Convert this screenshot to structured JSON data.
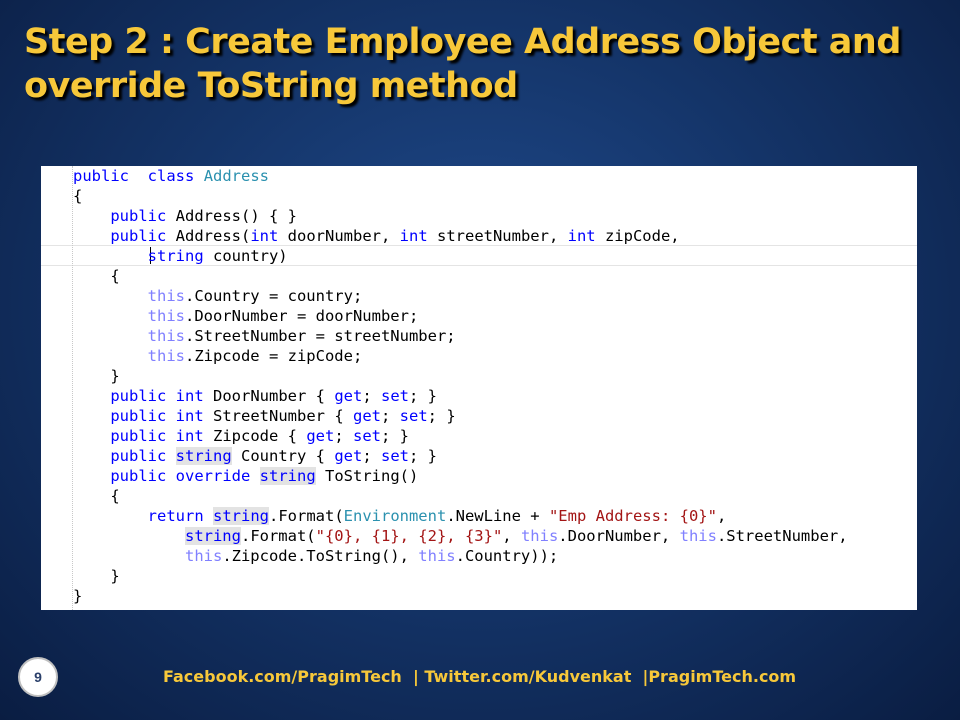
{
  "slide": {
    "title_line1": "Step 2 : Create Employee Address Object and",
    "title_line2": "override ToString method",
    "page_number": "9",
    "footer": "Facebook.com/PragimTech  | Twitter.com/Kudvenkat  |PragimTech.com"
  },
  "colors": {
    "title": "#f7c83a",
    "background": "#143468",
    "keyword": "#0000ff",
    "type": "#2b91af",
    "string": "#a31515",
    "this_keyword": "#8080ff"
  },
  "code": {
    "language": "C#",
    "lines": [
      [
        [
          "kw",
          "public"
        ],
        [
          "",
          "  "
        ],
        [
          "kw",
          "class"
        ],
        [
          "",
          " "
        ],
        [
          "ty",
          "Address"
        ]
      ],
      [
        [
          "",
          "{"
        ]
      ],
      [
        [
          "",
          "    "
        ],
        [
          "kw",
          "public"
        ],
        [
          "",
          " Address() { }"
        ]
      ],
      [
        [
          "",
          "    "
        ],
        [
          "kw",
          "public"
        ],
        [
          "",
          " Address("
        ],
        [
          "kw",
          "int"
        ],
        [
          "",
          " doorNumber, "
        ],
        [
          "kw",
          "int"
        ],
        [
          "",
          " streetNumber, "
        ],
        [
          "kw",
          "int"
        ],
        [
          "",
          " zipCode,"
        ]
      ],
      [
        [
          "",
          "        "
        ],
        [
          "kw",
          "string"
        ],
        [
          "",
          " country)"
        ]
      ],
      [
        [
          "",
          "    {"
        ]
      ],
      [
        [
          "",
          "        "
        ],
        [
          "ths",
          "this"
        ],
        [
          "",
          ".Country = country;"
        ]
      ],
      [
        [
          "",
          "        "
        ],
        [
          "ths",
          "this"
        ],
        [
          "",
          ".DoorNumber = doorNumber;"
        ]
      ],
      [
        [
          "",
          "        "
        ],
        [
          "ths",
          "this"
        ],
        [
          "",
          ".StreetNumber = streetNumber;"
        ]
      ],
      [
        [
          "",
          "        "
        ],
        [
          "ths",
          "this"
        ],
        [
          "",
          ".Zipcode = zipCode;"
        ]
      ],
      [
        [
          "",
          "    }"
        ]
      ],
      [
        [
          "",
          "    "
        ],
        [
          "kw",
          "public"
        ],
        [
          "",
          " "
        ],
        [
          "kw",
          "int"
        ],
        [
          "",
          " DoorNumber { "
        ],
        [
          "kw",
          "get"
        ],
        [
          "",
          "; "
        ],
        [
          "kw",
          "set"
        ],
        [
          "",
          "; }"
        ]
      ],
      [
        [
          "",
          "    "
        ],
        [
          "kw",
          "public"
        ],
        [
          "",
          " "
        ],
        [
          "kw",
          "int"
        ],
        [
          "",
          " StreetNumber { "
        ],
        [
          "kw",
          "get"
        ],
        [
          "",
          "; "
        ],
        [
          "kw",
          "set"
        ],
        [
          "",
          "; }"
        ]
      ],
      [
        [
          "",
          "    "
        ],
        [
          "kw",
          "public"
        ],
        [
          "",
          " "
        ],
        [
          "kw",
          "int"
        ],
        [
          "",
          " Zipcode { "
        ],
        [
          "kw",
          "get"
        ],
        [
          "",
          "; "
        ],
        [
          "kw",
          "set"
        ],
        [
          "",
          "; }"
        ]
      ],
      [
        [
          "",
          "    "
        ],
        [
          "kw",
          "public"
        ],
        [
          "",
          " "
        ],
        [
          "kw hl",
          "string"
        ],
        [
          "",
          " Country { "
        ],
        [
          "kw",
          "get"
        ],
        [
          "",
          "; "
        ],
        [
          "kw",
          "set"
        ],
        [
          "",
          "; }"
        ]
      ],
      [
        [
          "",
          "    "
        ],
        [
          "kw",
          "public"
        ],
        [
          "",
          " "
        ],
        [
          "kw",
          "override"
        ],
        [
          "",
          " "
        ],
        [
          "kw hl",
          "string"
        ],
        [
          "",
          " ToString()"
        ]
      ],
      [
        [
          "",
          "    {"
        ]
      ],
      [
        [
          "",
          "        "
        ],
        [
          "kw",
          "return"
        ],
        [
          "",
          " "
        ],
        [
          "kw hl",
          "string"
        ],
        [
          "",
          ".Format("
        ],
        [
          "ty",
          "Environment"
        ],
        [
          "",
          ".NewLine + "
        ],
        [
          "st",
          "\"Emp Address: {0}\""
        ],
        [
          "",
          ","
        ]
      ],
      [
        [
          "",
          "            "
        ],
        [
          "kw hl",
          "string"
        ],
        [
          "",
          ".Format("
        ],
        [
          "st",
          "\"{0}, {1}, {2}, {3}\""
        ],
        [
          "",
          ", "
        ],
        [
          "ths",
          "this"
        ],
        [
          "",
          ".DoorNumber, "
        ],
        [
          "ths",
          "this"
        ],
        [
          "",
          ".StreetNumber,"
        ]
      ],
      [
        [
          "",
          "            "
        ],
        [
          "ths",
          "this"
        ],
        [
          "",
          ".Zipcode.ToString(), "
        ],
        [
          "ths",
          "this"
        ],
        [
          "",
          ".Country));"
        ]
      ],
      [
        [
          "",
          "    }"
        ]
      ],
      [
        [
          "",
          "}"
        ]
      ]
    ]
  }
}
